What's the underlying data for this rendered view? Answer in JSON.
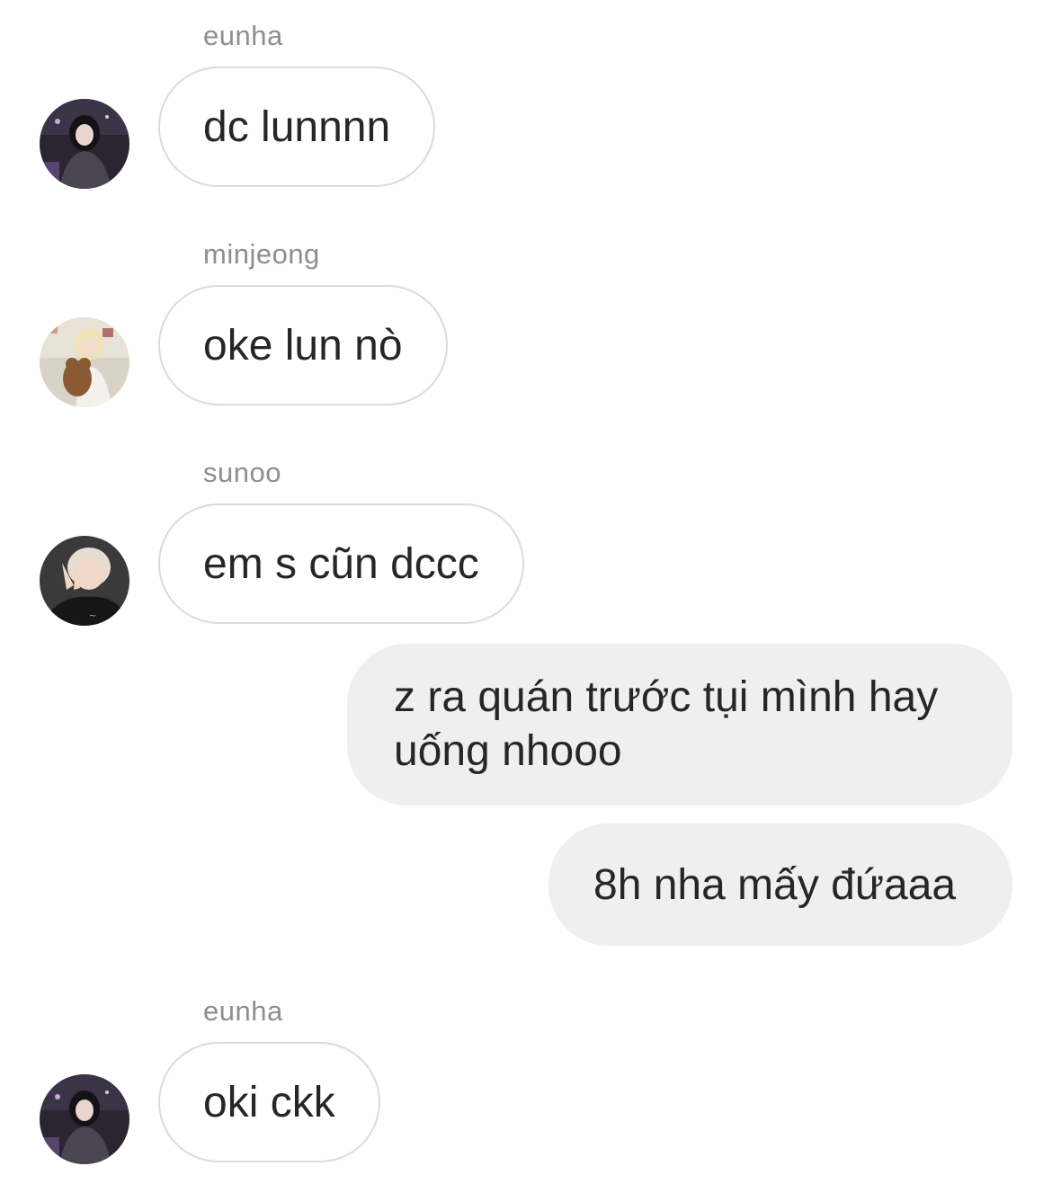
{
  "messages": [
    {
      "sender": "eunha",
      "text": "dc lunnnn",
      "avatar": "eunha-avatar"
    },
    {
      "sender": "minjeong",
      "text": "oke lun nò",
      "avatar": "minjeong-avatar"
    },
    {
      "sender": "sunoo",
      "text": "em s cũn dccc",
      "avatar": "sunoo-avatar"
    }
  ],
  "outgoing": [
    {
      "text": "z ra quán trước tụi mình hay uống nhooo"
    },
    {
      "text": "8h nha mấy đứaaa"
    }
  ],
  "last_message": {
    "sender": "eunha",
    "text": "oki ckk",
    "avatar": "eunha-avatar"
  },
  "colors": {
    "incoming_border": "#dbdbdb",
    "outgoing_bg": "#efefef",
    "name_text": "#8e8e8e",
    "message_text": "#262626"
  }
}
